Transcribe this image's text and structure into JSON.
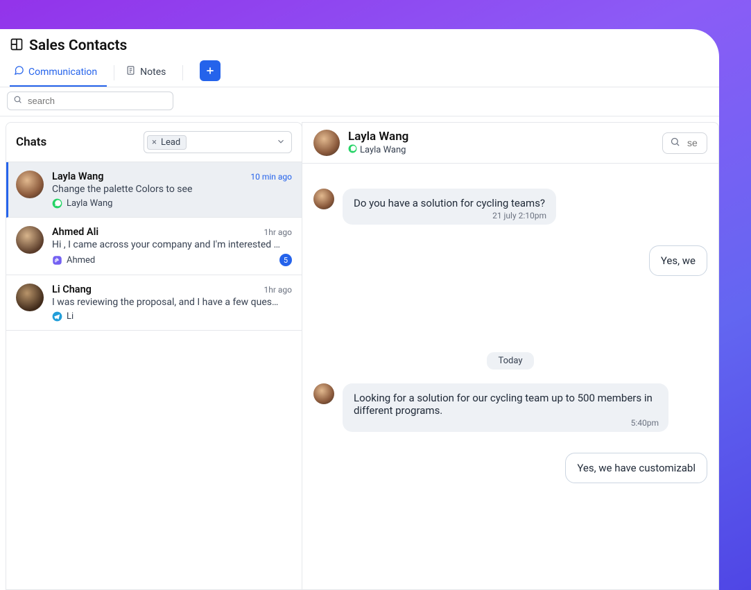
{
  "header": {
    "title": "Sales Contacts"
  },
  "tabs": {
    "communication": "Communication",
    "notes": "Notes"
  },
  "search": {
    "placeholder": "search"
  },
  "chats": {
    "title": "Chats",
    "filter_value": "Lead"
  },
  "chat_items": [
    {
      "name": "Layla Wang",
      "time": "10 min ago",
      "preview": "Change the palette Colors to see",
      "source": "Layla Wang",
      "src_type": "whatsapp",
      "active": true,
      "badge": ""
    },
    {
      "name": "Ahmed Ali",
      "time": "1hr ago",
      "preview": "Hi , I came across your company and I'm interested in learning m...",
      "source": "Ahmed",
      "src_type": "viber",
      "active": false,
      "badge": "5"
    },
    {
      "name": "Li Chang",
      "time": "1hr ago",
      "preview": "I was reviewing the proposal, and I have a few questions about t...",
      "source": "Li",
      "src_type": "telegram",
      "active": false,
      "badge": ""
    }
  ],
  "conversation": {
    "contact_name": "Layla Wang",
    "contact_sub": "Layla Wang",
    "search_placeholder": "se",
    "day_label": "Today",
    "messages": {
      "m1": {
        "text": "Do you have a solution for cycling teams?",
        "ts": "21 july 2:10pm"
      },
      "m2": {
        "text": "Yes, we"
      },
      "m3": {
        "text": "Looking for a solution for our cycling team up to 500 members in different programs.",
        "ts": "5:40pm"
      },
      "m4": {
        "text": "Yes, we have customizabl"
      }
    }
  }
}
